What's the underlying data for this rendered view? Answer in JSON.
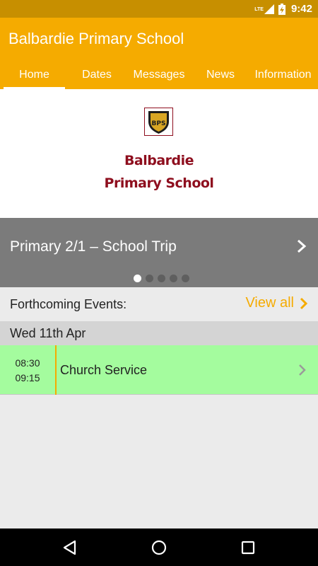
{
  "status_bar": {
    "network": "LTE",
    "time": "9:42",
    "icons": [
      "lte-signal-icon",
      "battery-charging-icon"
    ]
  },
  "app_bar": {
    "title": "Balbardie Primary School",
    "tabs": [
      {
        "label": "Home",
        "active": true
      },
      {
        "label": "Dates",
        "active": false
      },
      {
        "label": "Messages",
        "active": false
      },
      {
        "label": "News",
        "active": false
      },
      {
        "label": "Information",
        "active": false
      }
    ]
  },
  "school": {
    "crest_icon": "school-crest-icon",
    "name_line1": "Balbardie",
    "name_line2": "Primary School",
    "crest_initials": "BPS"
  },
  "carousel": {
    "title": "Primary 2/1 – School Trip",
    "page_count": 5,
    "active_page": 1
  },
  "events": {
    "heading": "Forthcoming Events:",
    "view_all_label": "View all",
    "date": "Wed 11th Apr",
    "items": [
      {
        "start": "08:30",
        "end": "09:15",
        "title": "Church Service"
      }
    ]
  },
  "colors": {
    "accent": "#f5ab00",
    "status_bar": "#c78f00",
    "school_name": "#8e0e1e",
    "event_bg": "#a4fc9e",
    "carousel_bg": "#7b7b7b"
  },
  "nav_bar": {
    "icons": [
      "back-icon",
      "home-icon",
      "recents-icon"
    ]
  }
}
